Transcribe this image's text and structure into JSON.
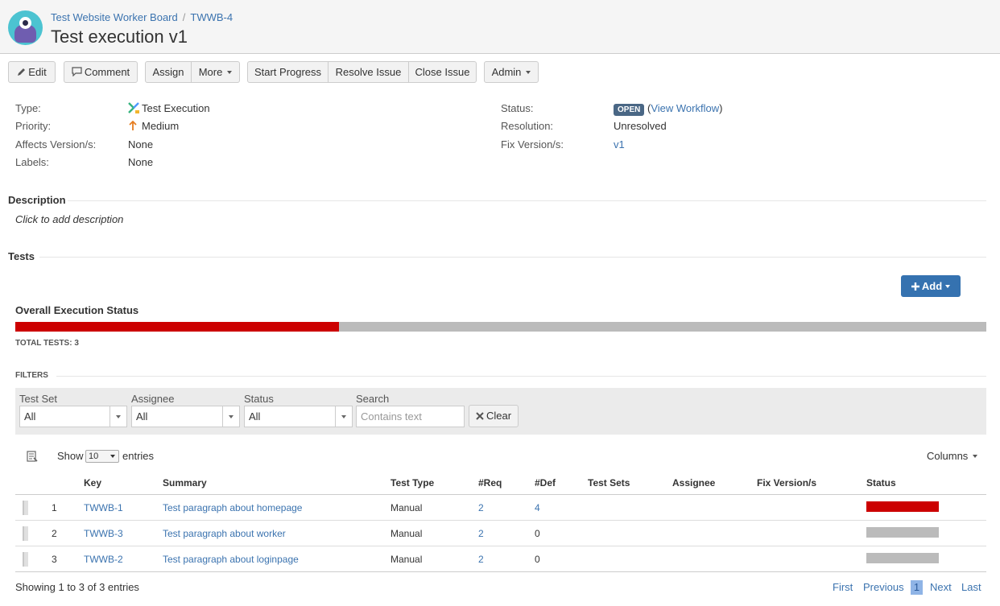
{
  "header": {
    "project": "Test Website Worker Board",
    "separator": "/",
    "issue_key": "TWWB-4",
    "title": "Test execution v1"
  },
  "toolbar": {
    "edit": "Edit",
    "comment": "Comment",
    "assign": "Assign",
    "more": "More",
    "start_progress": "Start Progress",
    "resolve_issue": "Resolve Issue",
    "close_issue": "Close Issue",
    "admin": "Admin"
  },
  "details": {
    "type_label": "Type:",
    "type_value": "Test Execution",
    "priority_label": "Priority:",
    "priority_value": "Medium",
    "affects_label": "Affects Version/s:",
    "affects_value": "None",
    "labels_label": "Labels:",
    "labels_value": "None",
    "status_label": "Status:",
    "status_value": "OPEN",
    "status_open_paren": "(",
    "view_workflow": "View Workflow",
    "status_close_paren": ")",
    "resolution_label": "Resolution:",
    "resolution_value": "Unresolved",
    "fix_label": "Fix Version/s:",
    "fix_value": "v1"
  },
  "description": {
    "heading": "Description",
    "placeholder": "Click to add description"
  },
  "tests": {
    "heading": "Tests",
    "add_button": "Add",
    "overall_heading": "Overall Execution Status",
    "failed_fraction": 0.3333,
    "total_tests": "TOTAL TESTS: 3",
    "filters_heading": "FILTERS",
    "filters": {
      "test_set_label": "Test Set",
      "test_set_value": "All",
      "assignee_label": "Assignee",
      "assignee_value": "All",
      "status_label": "Status",
      "status_value": "All",
      "search_label": "Search",
      "search_placeholder": "Contains text",
      "clear": "Clear"
    },
    "show_label": "Show",
    "page_size": "10",
    "entries_label": "entries",
    "columns_button": "Columns",
    "headers": {
      "key": "Key",
      "summary": "Summary",
      "test_type": "Test Type",
      "req": "#Req",
      "def": "#Def",
      "test_sets": "Test Sets",
      "assignee": "Assignee",
      "fix_version": "Fix Version/s",
      "status": "Status"
    },
    "rows": [
      {
        "rank": "1",
        "key": "TWWB-1",
        "summary": "Test paragraph about homepage",
        "test_type": "Manual",
        "req": "2",
        "def": "4",
        "status_color": "#cc0000"
      },
      {
        "rank": "2",
        "key": "TWWB-3",
        "summary": "Test paragraph about worker",
        "test_type": "Manual",
        "req": "2",
        "def": "0",
        "status_color": "#bbbbbb"
      },
      {
        "rank": "3",
        "key": "TWWB-2",
        "summary": "Test paragraph about loginpage",
        "test_type": "Manual",
        "req": "2",
        "def": "0",
        "status_color": "#bbbbbb"
      }
    ],
    "showing": "Showing 1 to 3 of 3 entries",
    "pager": {
      "first": "First",
      "previous": "Previous",
      "current": "1",
      "next": "Next",
      "last": "Last"
    }
  },
  "colors": {
    "failed": "#cc0000",
    "todo": "#bbbbbb",
    "accent": "#3572b0",
    "link": "#3b73af"
  }
}
